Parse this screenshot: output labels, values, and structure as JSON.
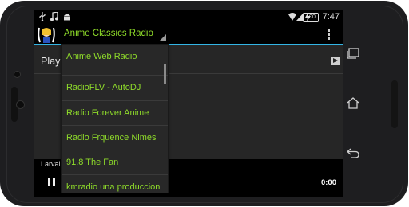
{
  "status_bar": {
    "time": "7:47",
    "battery_percent": "100",
    "icons": [
      "usb-icon",
      "music-note-icon",
      "android-icon",
      "wifi-icon",
      "signal-icon",
      "charging-icon"
    ]
  },
  "action_bar": {
    "selected_station": "Anime Classics Radio",
    "menu_icon": "overflow-menu-icon"
  },
  "dropdown": {
    "items": [
      "Anime Web Radio",
      "RadioFLV - AutoDJ",
      "Radio Forever Anime",
      "Radio Frquence Nimes",
      "91.8 The Fan",
      "kmradio una produccion"
    ]
  },
  "content": {
    "play_label": "Play"
  },
  "player": {
    "now_playing": "Larval",
    "elapsed": "0:00"
  },
  "colors": {
    "accent_green": "#8fdc2a",
    "holo_blue": "#33b5e5",
    "panel_bg": "#262626"
  }
}
